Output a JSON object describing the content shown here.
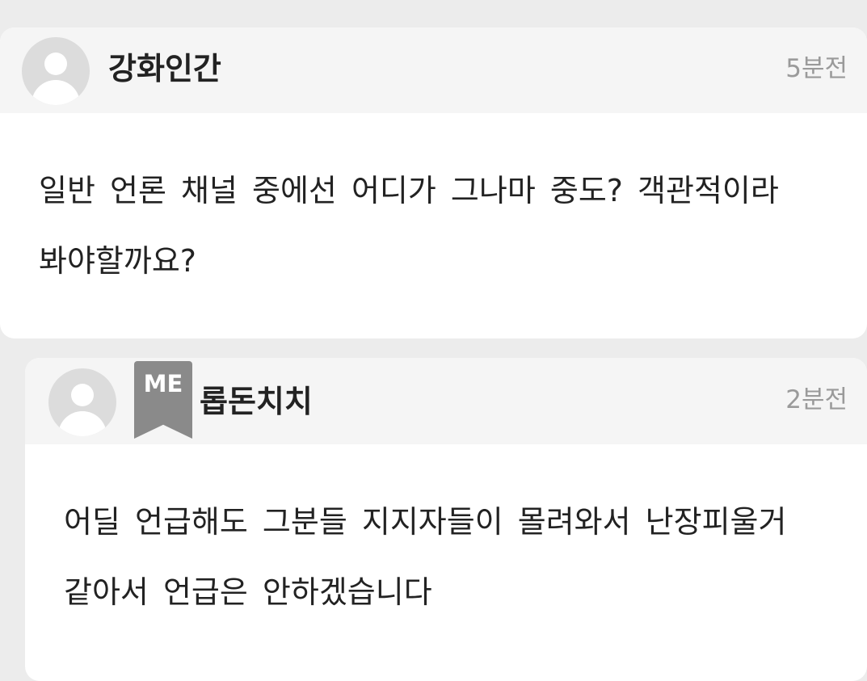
{
  "comments": [
    {
      "author": "강화인간",
      "time": "5분전",
      "lines": [
        "일반 언론 채널 중에선 어디가 그나마 중도? 객관적이라",
        "봐야할까요?"
      ]
    },
    {
      "author": "롭돈치치",
      "time": "2분전",
      "badge": "ME",
      "lines": [
        "어딜 언급해도 그분들 지지자들이 몰려와서 난장피울거",
        "같아서 언급은 안하겠습니다"
      ]
    }
  ],
  "colors": {
    "page_background": "#ececec",
    "header_background": "#f5f5f5",
    "badge": "#8a8a8a",
    "timestamp": "#9a9a9a"
  },
  "icons": {
    "avatar": "user-avatar-icon",
    "badge": "bookmark-ribbon-icon"
  }
}
